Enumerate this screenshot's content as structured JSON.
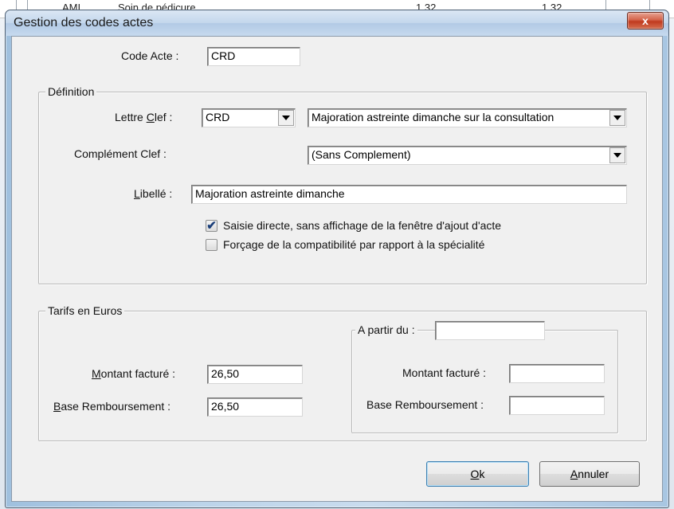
{
  "background": {
    "row_cells": [
      "AMI",
      "Soin de pédicure",
      "1,32",
      "1,32"
    ]
  },
  "window": {
    "title": "Gestion des codes actes",
    "close_glyph": "x"
  },
  "code_acte": {
    "label": "Code Acte :",
    "value": "CRD"
  },
  "definition": {
    "title": "Définition",
    "lettre_clef": {
      "label_prefix": "Lettre ",
      "label_accel": "C",
      "label_suffix": "lef :",
      "value": "CRD",
      "description": "Majoration astreinte dimanche sur la consultation"
    },
    "complement_clef": {
      "label": "Complément Clef :",
      "value": "(Sans Complement)"
    },
    "libelle": {
      "label_accel": "L",
      "label_suffix": "ibellé :",
      "value": "Majoration astreinte dimanche"
    },
    "saisie_directe": {
      "label": "Saisie directe, sans affichage de la fenêtre d'ajout d'acte",
      "checked": true
    },
    "forcage": {
      "label": "Forçage de la compatibilité par rapport à la spécialité",
      "checked": false
    }
  },
  "tarifs": {
    "title": "Tarifs en Euros",
    "montant_facture": {
      "label_accel": "M",
      "label_suffix": "ontant facturé :",
      "value": "26,50"
    },
    "base_remboursement": {
      "label_accel": "B",
      "label_suffix": "ase Remboursement :",
      "value": "26,50"
    },
    "a_partir_du": {
      "title": "A partir du :",
      "date_value": "",
      "montant_label": "Montant facturé :",
      "montant_value": "",
      "base_label": "Base Remboursement :",
      "base_value": ""
    }
  },
  "buttons": {
    "ok_accel": "O",
    "ok_suffix": "k",
    "cancel_accel": "A",
    "cancel_suffix": "nnuler"
  }
}
